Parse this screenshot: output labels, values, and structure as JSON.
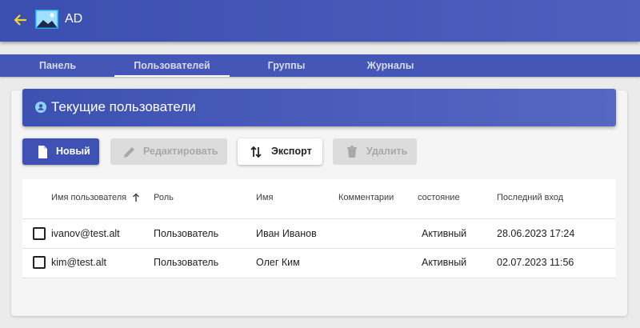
{
  "header": {
    "title": "AD",
    "back_icon": "arrow-left-icon",
    "logo_icon": "image-icon",
    "back_color": "#f2d43a"
  },
  "tabs": [
    {
      "label": "Панель"
    },
    {
      "label": "Пользователей"
    },
    {
      "label": "Группы"
    },
    {
      "label": "Журналы"
    }
  ],
  "card": {
    "title": "Текущие пользователи",
    "icon": "user-circle-icon"
  },
  "toolbar": {
    "new_label": "Новый",
    "edit_label": "Редактировать",
    "export_label": "Экспорт",
    "delete_label": "Удалить"
  },
  "table": {
    "columns": [
      "Имя пользователя",
      "Роль",
      "Имя",
      "Комментарии",
      "состояние",
      "Последний вход"
    ],
    "sort_icon": "arrow-up-icon",
    "rows": [
      {
        "username": "ivanov@test.alt",
        "role": "Пользователь",
        "name": "Иван Иванов",
        "comment": "",
        "state": "Активный",
        "last_login": "28.06.2023 17:24"
      },
      {
        "username": "kim@test.alt",
        "role": "Пользователь",
        "name": "Олег Ким",
        "comment": "",
        "state": "Активный",
        "last_login": "02.07.2023 11:56"
      }
    ]
  },
  "colors": {
    "primary": "#3f51b5",
    "header": "#4456b6"
  }
}
